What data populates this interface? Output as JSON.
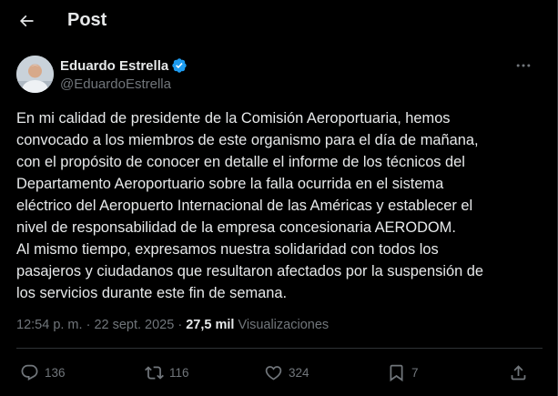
{
  "header": {
    "title": "Post"
  },
  "author": {
    "name": "Eduardo Estrella",
    "handle": "@EduardoEstrella",
    "verified": true,
    "verified_color": "#1d9bf0"
  },
  "post": {
    "lines": [
      "En mi calidad de presidente de la Comisión Aeroportuaria, hemos",
      "convocado a los miembros de este organismo para el día de mañana,",
      "con el propósito de conocer en detalle el informe de los técnicos del",
      "Departamento Aeroportuario sobre la falla ocurrida en el sistema",
      "eléctrico del Aeropuerto Internacional de las Américas y establecer el",
      "nivel de responsabilidad de la empresa concesionaria AERODOM.",
      "Al mismo tiempo, expresamos nuestra solidaridad con todos los",
      "pasajeros y ciudadanos que resultaron afectados por la suspensión de",
      "los servicios durante este fin de semana."
    ]
  },
  "meta": {
    "time": "12:54 p. m.",
    "separator": " · ",
    "date": "22 sept. 2025",
    "views_count": "27,5 mil",
    "views_label": " Visualizaciones"
  },
  "actions": {
    "replies": "136",
    "reposts": "116",
    "likes": "324",
    "bookmarks": "7"
  },
  "icons": {
    "back": "arrow-left-icon",
    "more": "more-horizontal-icon",
    "reply": "reply-icon",
    "repost": "repost-icon",
    "like": "heart-icon",
    "bookmark": "bookmark-icon",
    "share": "share-icon"
  },
  "colors": {
    "background": "#000000",
    "text": "#e7e9ea",
    "secondary_text": "#71767b",
    "divider": "#2f3336"
  }
}
